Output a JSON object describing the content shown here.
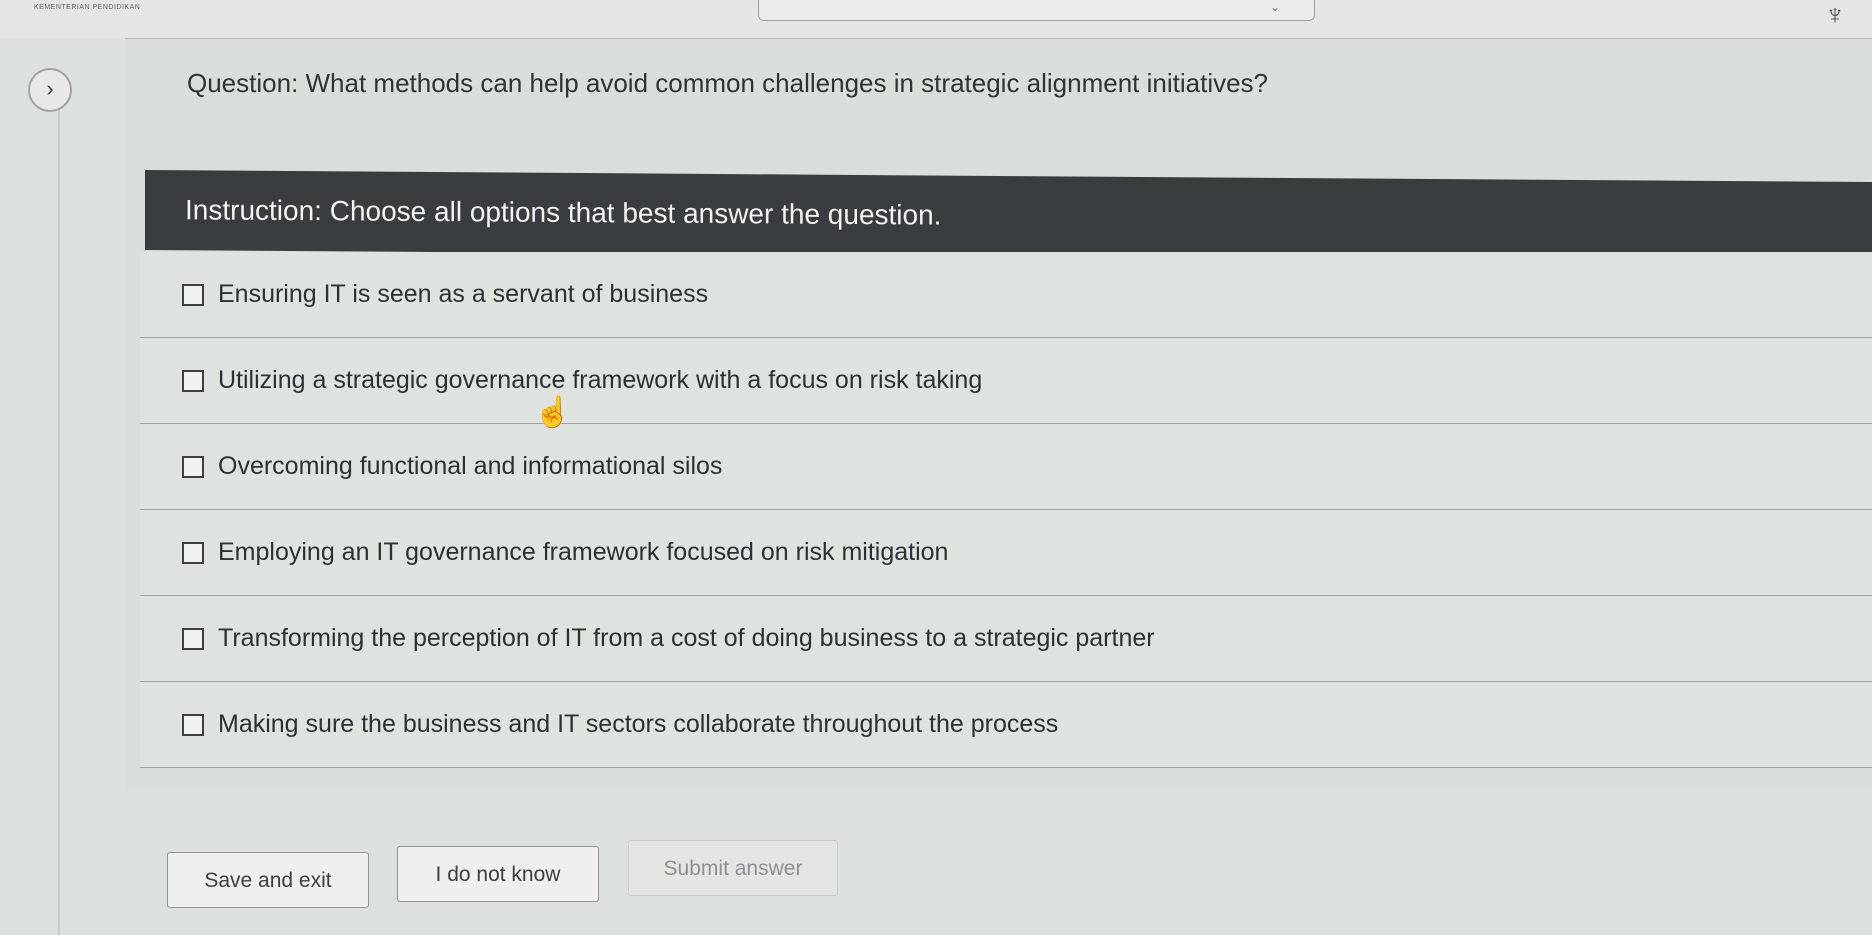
{
  "topbar": {
    "app_title": "KEMENTERIAN PENDIDIKAN",
    "trophy_icon": "trophy-icon",
    "chevron_icon": "chevron-down-icon"
  },
  "nav": {
    "expand_icon": "chevron-right-icon",
    "expand_glyph": "›"
  },
  "question": {
    "text": "Question: What methods can help avoid common challenges in strategic alignment initiatives?"
  },
  "instruction": {
    "text": "Instruction: Choose all options that best answer the question."
  },
  "options": [
    {
      "label": "Ensuring IT is seen as a servant of business",
      "checked": false
    },
    {
      "label": "Utilizing a strategic governance framework with a focus on risk taking",
      "checked": false
    },
    {
      "label": "Overcoming functional and informational silos",
      "checked": false
    },
    {
      "label": "Employing an IT governance framework focused on risk mitigation",
      "checked": false
    },
    {
      "label": "Transforming the perception of IT from a cost of doing business to a strategic partner",
      "checked": false
    },
    {
      "label": "Making sure the business and IT sectors collaborate throughout the process",
      "checked": false
    }
  ],
  "buttons": {
    "save_exit": "Save and exit",
    "dont_know": "I do not know",
    "submit": "Submit answer"
  },
  "colors": {
    "instruction_bg": "#3a3d40",
    "page_bg": "#d9dedb"
  }
}
